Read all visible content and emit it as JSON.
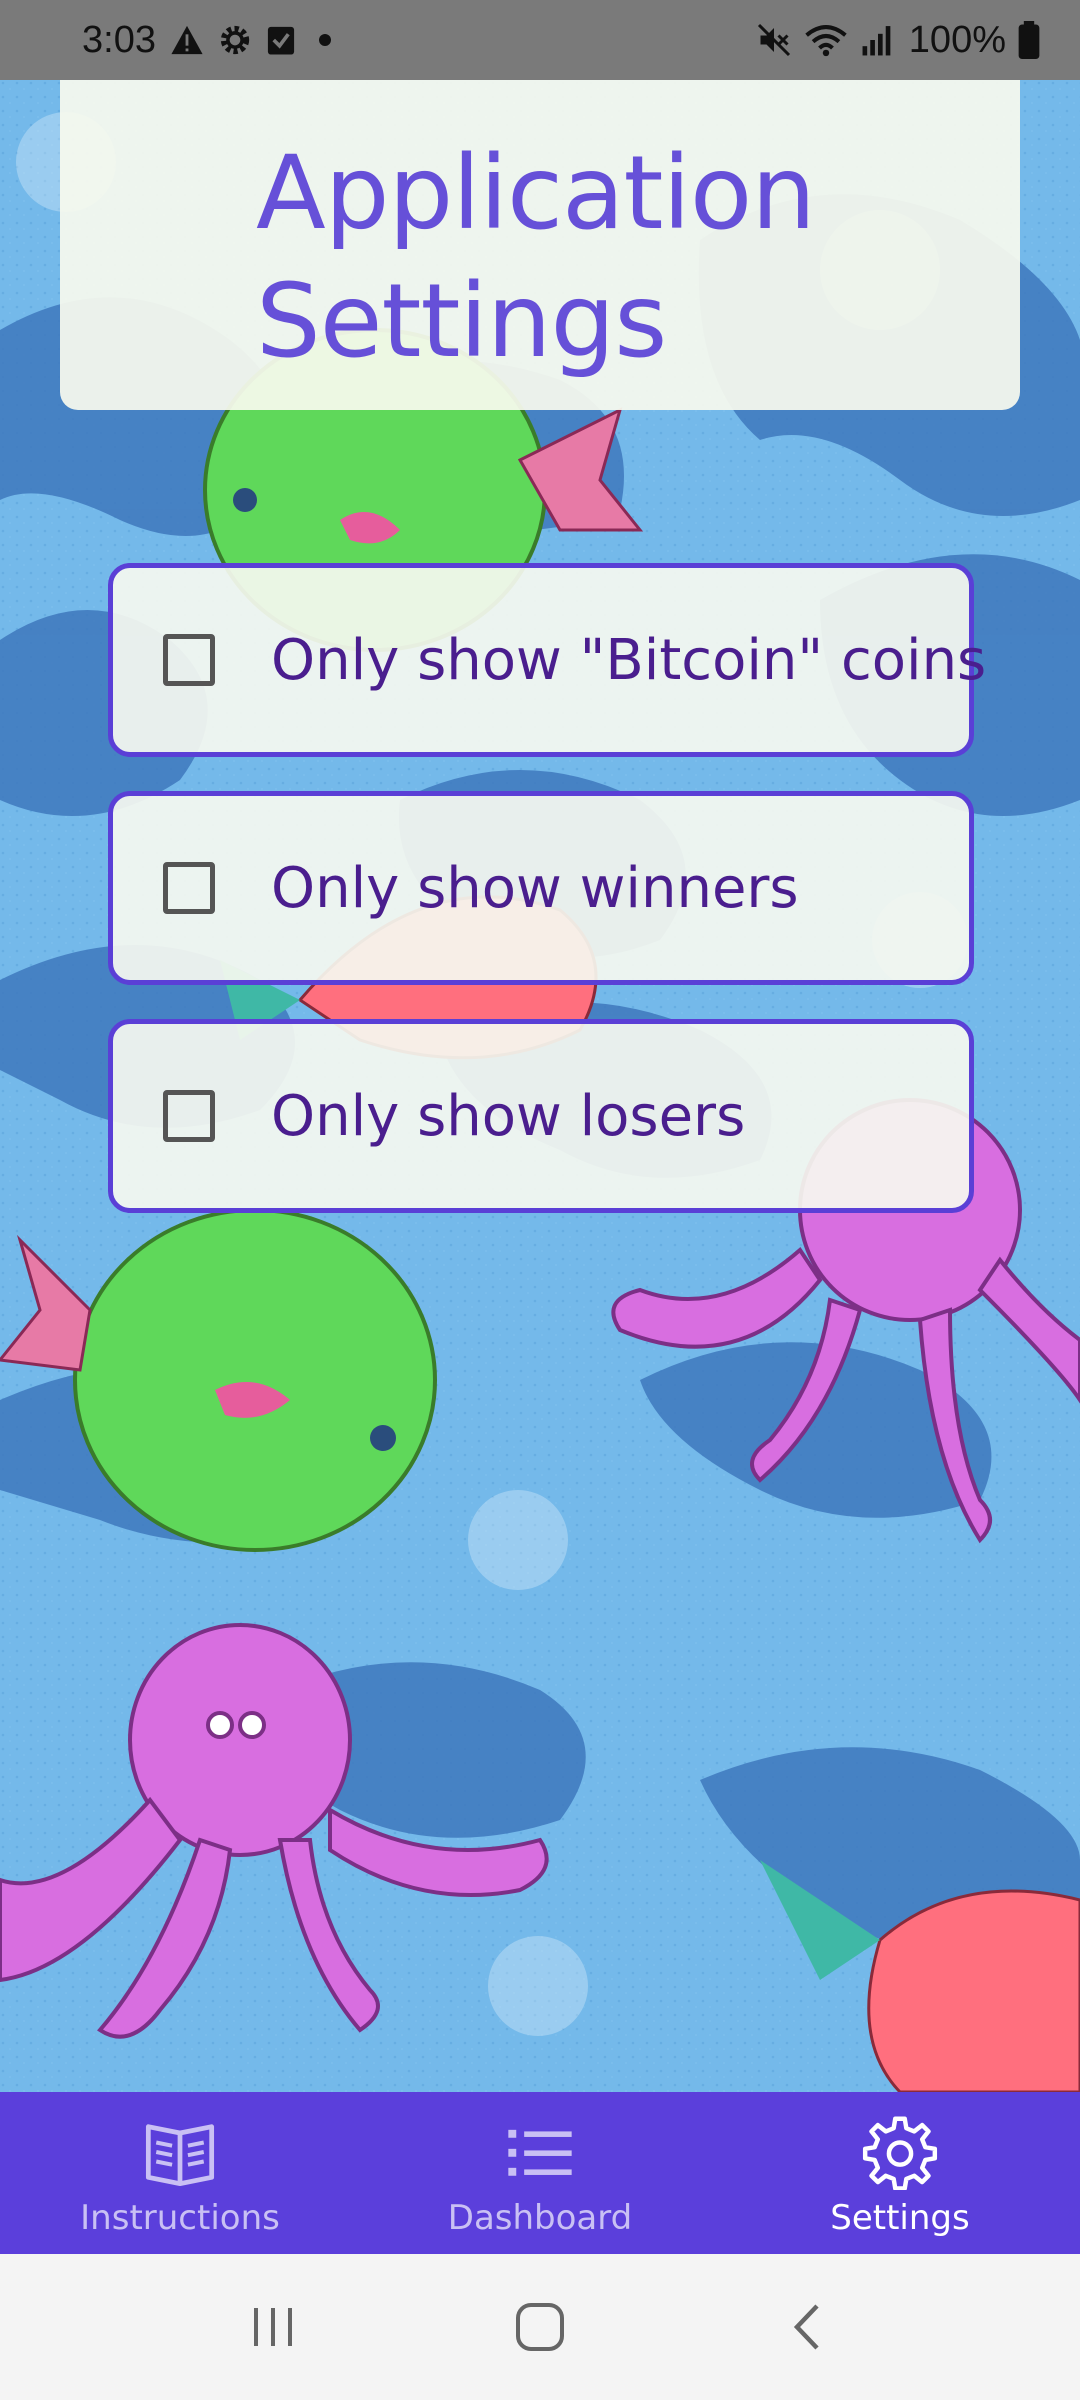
{
  "status_bar": {
    "time": "3:03",
    "battery": "100%",
    "left_icons": [
      "warning-icon",
      "gear-icon",
      "checkbox-icon",
      "dot-icon"
    ],
    "right_icons": [
      "mute-icon",
      "wifi-icon",
      "signal-icon",
      "battery-icon"
    ]
  },
  "settings": {
    "title_line1": "Application",
    "title_line2": "Settings",
    "options": [
      {
        "label": "Only show \"Bitcoin\" coins",
        "checked": false
      },
      {
        "label": "Only show winners",
        "checked": false
      },
      {
        "label": "Only show losers",
        "checked": false
      }
    ]
  },
  "bottom_nav": {
    "items": [
      {
        "label": "Instructions",
        "icon": "book-icon",
        "active": false
      },
      {
        "label": "Dashboard",
        "icon": "list-icon",
        "active": false
      },
      {
        "label": "Settings",
        "icon": "gear-icon",
        "active": true
      }
    ]
  },
  "system_nav": {
    "buttons": [
      "recents-icon",
      "home-icon",
      "back-icon"
    ]
  },
  "colors": {
    "accent": "#5b3fdb",
    "title": "#6650d8",
    "option_text": "#4a1e8e",
    "water": "#6fb6e8"
  }
}
